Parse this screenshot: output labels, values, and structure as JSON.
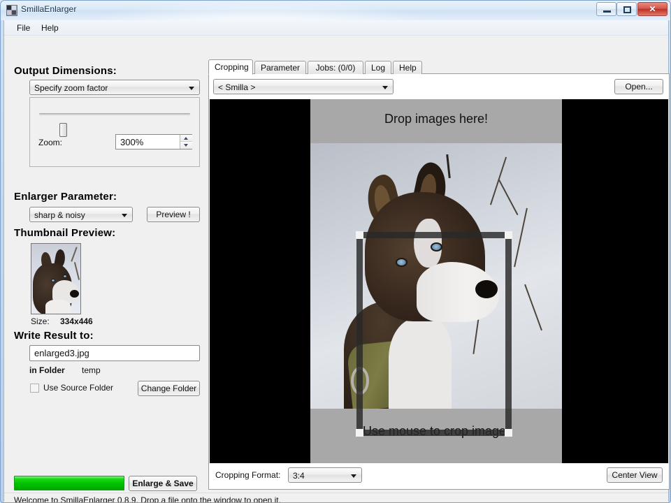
{
  "window": {
    "title": "SmillaEnlarger",
    "icon": "app-icon",
    "controls": {
      "minimize": "minimize-icon",
      "maximize": "maximize-icon",
      "close": "✕"
    }
  },
  "menubar": {
    "items": [
      {
        "label": "File"
      },
      {
        "label": "Help"
      }
    ]
  },
  "left_panel": {
    "output_dimensions": {
      "heading": "Output Dimensions:",
      "mode_combo": {
        "value": "Specify zoom factor"
      },
      "zoom_label": "Zoom:",
      "zoom_value": "300%",
      "slider_position_percent": 13
    },
    "enlarger_parameter": {
      "heading": "Enlarger Parameter:",
      "preset_combo": {
        "value": "sharp & noisy"
      },
      "preview_button": "Preview !"
    },
    "thumbnail_preview": {
      "heading": "Thumbnail Preview:",
      "size_label": "Size:",
      "size_value": "334x446"
    },
    "write_result": {
      "heading": "Write Result to:",
      "filename": "enlarged3.jpg",
      "in_folder_label": "in Folder",
      "folder_value": "temp",
      "use_source_folder_label": "Use Source Folder",
      "use_source_folder_checked": false,
      "change_folder_button": "Change Folder"
    },
    "actions": {
      "progress_percent": 100,
      "progress_color": "#00c000",
      "enlarge_save_button": "Enlarge & Save"
    }
  },
  "statusbar": {
    "text": "Welcome to SmillaEnlarger 0.8.9.  Drop a file onto the window to open it."
  },
  "right_panel": {
    "tabs": [
      {
        "label": "Cropping",
        "active": true
      },
      {
        "label": "Parameter",
        "active": false
      },
      {
        "label": "Jobs: (0/0)",
        "active": false
      },
      {
        "label": "Log",
        "active": false
      },
      {
        "label": "Help",
        "active": false
      }
    ],
    "source_combo": {
      "value": "< Smilla >"
    },
    "open_button": "Open...",
    "canvas": {
      "drop_text": "Drop images here!",
      "hint_text": "Use mouse to crop image.",
      "background_color": "#000000",
      "banner_color": "#a8a8a8"
    },
    "bottom_bar": {
      "cropping_format_label": "Cropping Format:",
      "cropping_format_combo": {
        "value": "3:4"
      },
      "center_view_button": "Center View"
    }
  }
}
